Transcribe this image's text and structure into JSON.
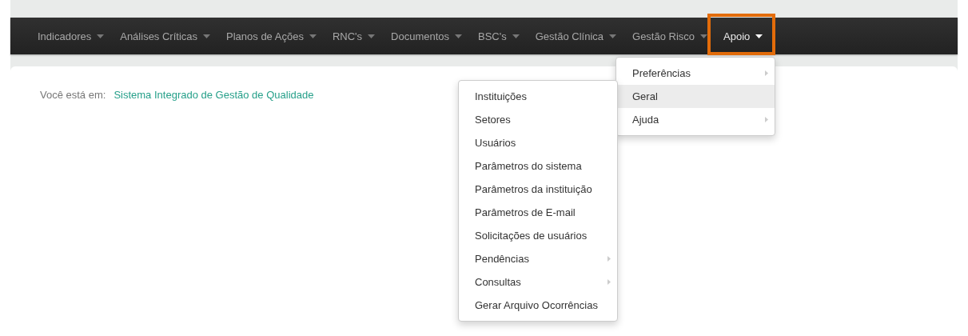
{
  "navbar": {
    "items": [
      {
        "label": "Indicadores",
        "selected": false
      },
      {
        "label": "Análises Críticas",
        "selected": false
      },
      {
        "label": "Planos de Ações",
        "selected": false
      },
      {
        "label": "RNC's",
        "selected": false
      },
      {
        "label": "Documentos",
        "selected": false
      },
      {
        "label": "BSC's",
        "selected": false
      },
      {
        "label": "Gestão Clínica",
        "selected": false
      },
      {
        "label": "Gestão Risco",
        "selected": false
      },
      {
        "label": "Apoio",
        "selected": true
      }
    ]
  },
  "breadcrumb": {
    "label": "Você está em:",
    "link": "Sistema Integrado de Gestão de Qualidade"
  },
  "apoio_menu": {
    "items": [
      {
        "label": "Preferências",
        "kind": "submenu",
        "selected": false
      },
      {
        "label": "Geral",
        "kind": "submenu-open",
        "selected": true
      },
      {
        "label": "Ajuda",
        "kind": "submenu",
        "selected": false
      }
    ]
  },
  "geral_menu": {
    "items": [
      {
        "label": "Instituições",
        "kind": "link"
      },
      {
        "label": "Setores",
        "kind": "link"
      },
      {
        "label": "Usuários",
        "kind": "link"
      },
      {
        "label": "Parâmetros do sistema",
        "kind": "link"
      },
      {
        "label": "Parâmetros da instituição",
        "kind": "link"
      },
      {
        "label": "Parâmetros de E-mail",
        "kind": "link"
      },
      {
        "label": "Solicitações de usuários",
        "kind": "link"
      },
      {
        "label": "Pendências",
        "kind": "submenu"
      },
      {
        "label": "Consultas",
        "kind": "submenu"
      },
      {
        "label": "Gerar Arquivo Ocorrências",
        "kind": "link"
      }
    ]
  }
}
